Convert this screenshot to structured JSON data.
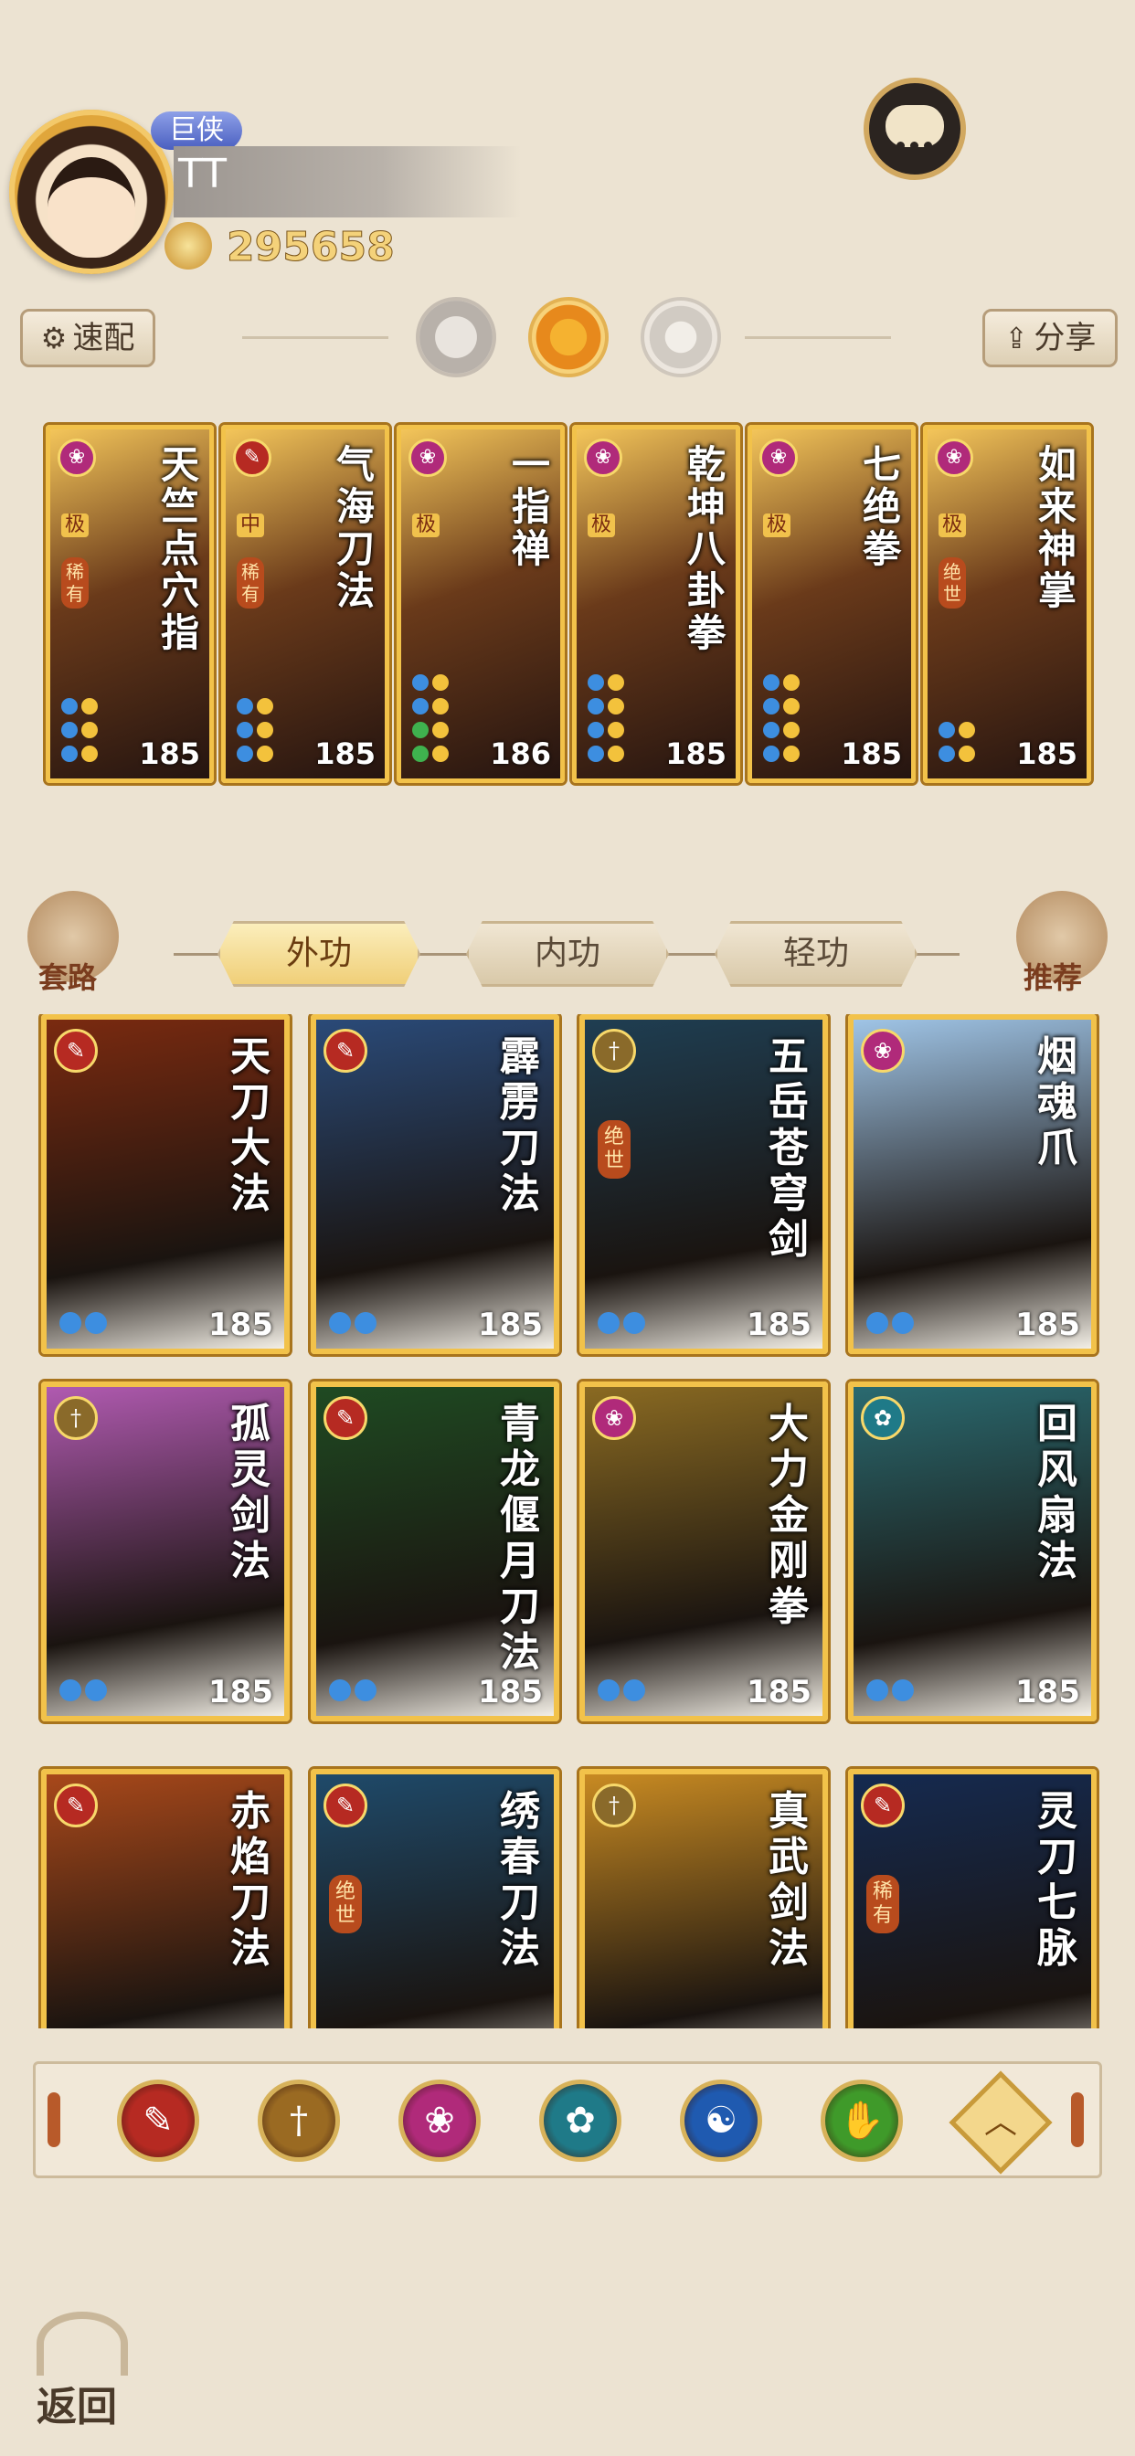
{
  "player": {
    "title_badge": "巨侠",
    "name": "TT",
    "power": "295658"
  },
  "toolbar": {
    "speed_label": "速配",
    "share_label": "分享"
  },
  "equipped": [
    {
      "name": "天竺点穴指",
      "tier": "极",
      "rarity": "稀有",
      "level": "185",
      "elem": "❀",
      "elem_color": "#b02a7a",
      "pips": [
        "b",
        "y",
        "b",
        "y",
        "b",
        "y"
      ]
    },
    {
      "name": "气海刀法",
      "tier": "中",
      "rarity": "稀有",
      "level": "185",
      "elem": "✎",
      "elem_color": "#b62a22",
      "pips": [
        "b",
        "y",
        "b",
        "y",
        "b",
        "y"
      ]
    },
    {
      "name": "一指禅",
      "tier": "极",
      "rarity": "",
      "level": "186",
      "elem": "❀",
      "elem_color": "#b02a7a",
      "pips": [
        "b",
        "y",
        "b",
        "y",
        "g",
        "y",
        "g",
        "y"
      ]
    },
    {
      "name": "乾坤八卦拳",
      "tier": "极",
      "rarity": "",
      "level": "185",
      "elem": "❀",
      "elem_color": "#b02a7a",
      "pips": [
        "b",
        "y",
        "b",
        "y",
        "b",
        "y",
        "b",
        "y"
      ]
    },
    {
      "name": "七绝拳",
      "tier": "极",
      "rarity": "",
      "level": "185",
      "elem": "❀",
      "elem_color": "#b02a7a",
      "pips": [
        "b",
        "y",
        "b",
        "y",
        "b",
        "y",
        "b",
        "y"
      ]
    },
    {
      "name": "如来神掌",
      "tier": "极",
      "rarity": "绝世",
      "level": "185",
      "elem": "❀",
      "elem_color": "#b02a7a",
      "pips": [
        "b",
        "y",
        "b",
        "y"
      ]
    }
  ],
  "side_buttons": {
    "set_label": "套路",
    "recommend_label": "推荐"
  },
  "tabs": [
    {
      "label": "外功",
      "active": true
    },
    {
      "label": "内功",
      "active": false
    },
    {
      "label": "轻功",
      "active": false
    }
  ],
  "skills": [
    {
      "name": "天刀大法",
      "level": "185",
      "rarity": "",
      "elem": "✎",
      "elem_color": "#b62a22",
      "bg": "#7a2a10"
    },
    {
      "name": "霹雳刀法",
      "level": "185",
      "rarity": "",
      "elem": "✎",
      "elem_color": "#b62a22",
      "bg": "#2a4a78"
    },
    {
      "name": "五岳苍穹剑",
      "level": "185",
      "rarity": "绝世",
      "elem": "†",
      "elem_color": "#8a6a2a",
      "bg": "#1f3e52"
    },
    {
      "name": "烟魂爪",
      "level": "185",
      "rarity": "",
      "elem": "❀",
      "elem_color": "#b02a7a",
      "bg": "#9fc4e6"
    },
    {
      "name": "孤灵剑法",
      "level": "185",
      "rarity": "",
      "elem": "†",
      "elem_color": "#8a6a2a",
      "bg": "#b05ab0"
    },
    {
      "name": "青龙偃月刀法",
      "level": "185",
      "rarity": "",
      "elem": "✎",
      "elem_color": "#b62a22",
      "bg": "#1f4a22"
    },
    {
      "name": "大力金刚拳",
      "level": "185",
      "rarity": "",
      "elem": "❀",
      "elem_color": "#b02a7a",
      "bg": "#8a6a22"
    },
    {
      "name": "回风扇法",
      "level": "185",
      "rarity": "",
      "elem": "✿",
      "elem_color": "#1f7a88",
      "bg": "#2a6a70"
    },
    {
      "name": "赤焰刀法",
      "level": "",
      "rarity": "",
      "elem": "✎",
      "elem_color": "#b62a22",
      "bg": "#a8481a"
    },
    {
      "name": "绣春刀法",
      "level": "",
      "rarity": "绝世",
      "elem": "✎",
      "elem_color": "#b62a22",
      "bg": "#1f4a6a"
    },
    {
      "name": "真武剑法",
      "level": "",
      "rarity": "",
      "elem": "†",
      "elem_color": "#8a6a2a",
      "bg": "#c88a22"
    },
    {
      "name": "灵刀七脉",
      "level": "",
      "rarity": "稀有",
      "elem": "✎",
      "elem_color": "#b62a22",
      "bg": "#152a50"
    }
  ],
  "filters": [
    {
      "name": "blade",
      "glyph": "✎",
      "color": "#b62a22"
    },
    {
      "name": "sword",
      "glyph": "†",
      "color": "#9a6a22"
    },
    {
      "name": "fist",
      "glyph": "❀",
      "color": "#b02a7a"
    },
    {
      "name": "fan",
      "glyph": "✿",
      "color": "#1f7a88"
    },
    {
      "name": "taiji",
      "glyph": "☯",
      "color": "#1f5ab0"
    },
    {
      "name": "palm",
      "glyph": "✋",
      "color": "#3f9a2a"
    }
  ],
  "collapse_glyph": "︿",
  "back_label": "返回"
}
